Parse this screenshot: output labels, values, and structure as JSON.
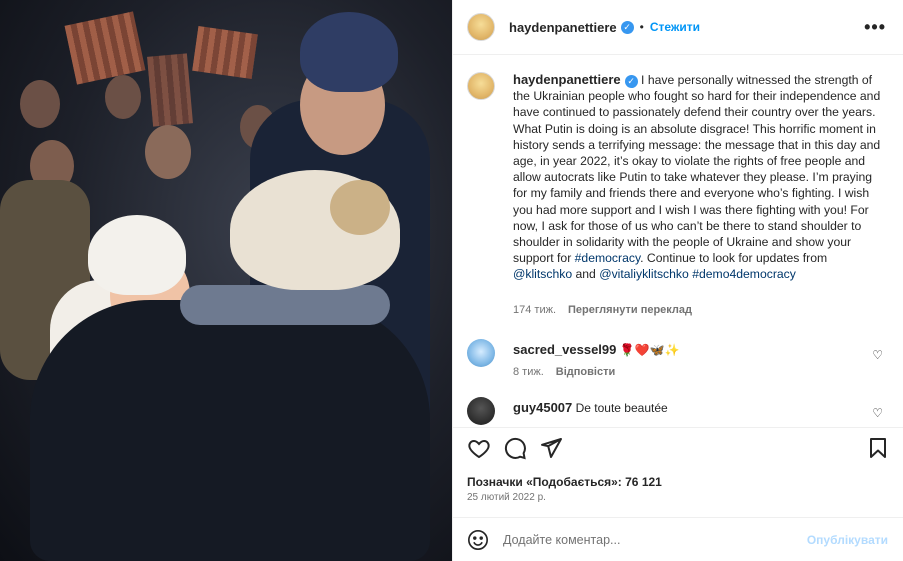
{
  "post": {
    "username": "haydenpanettiere",
    "verified_icon": "verified-badge-icon",
    "separator": "•",
    "follow_label": "Стежити",
    "more_label": "•••"
  },
  "caption": {
    "username": "haydenpanettiere",
    "text": " I have personally witnessed the strength of the Ukrainian people who fought so hard for their independence and have continued to passionately defend their country over the years. What Putin is doing is an absolute disgrace! This horrific moment in history sends a terrifying message: the message that in this day and age, in year 2022, it’s okay to violate the rights of free people and allow autocrats like Putin to take whatever they please. I’m praying for my family and friends there and everyone who’s fighting. I wish you had more support and I wish I was there fighting with you! For now, I ask for those of us who can’t be there to stand shoulder to shoulder in solidarity with the people of Ukraine and show your support for ",
    "hashtag1": "#democracy",
    "text2": ". Continue to look for updates from ",
    "mention1": "@klitschko",
    "text3": " and ",
    "mention2": "@vitaliyklitschko",
    "text4": " ",
    "hashtag2": "#demo4democracy",
    "age": "174 тиж.",
    "translate_label": "Переглянути переклад"
  },
  "comments": [
    {
      "username": "sacred_vessel99",
      "text": "🌹❤️🦋✨",
      "age": "8 тиж.",
      "reply_label": "Відповісти",
      "avatar_color": "#7fb8e6"
    },
    {
      "username": "guy45007",
      "text": "De toute beautée",
      "avatar_color": "#2b2b2b"
    }
  ],
  "actions": {
    "like_icon": "heart-icon",
    "comment_icon": "comment-icon",
    "share_icon": "share-icon",
    "save_icon": "bookmark-icon"
  },
  "likes_text": "Позначки «Подобається»: 76 121",
  "date_text": "25 лютий 2022 р.",
  "composer": {
    "placeholder": "Додайте коментар...",
    "publish_label": "Опублікувати"
  },
  "colors": {
    "accent": "#0095f6",
    "link": "#00376b",
    "muted": "#737373",
    "publish_disabled": "#b3dbff"
  }
}
